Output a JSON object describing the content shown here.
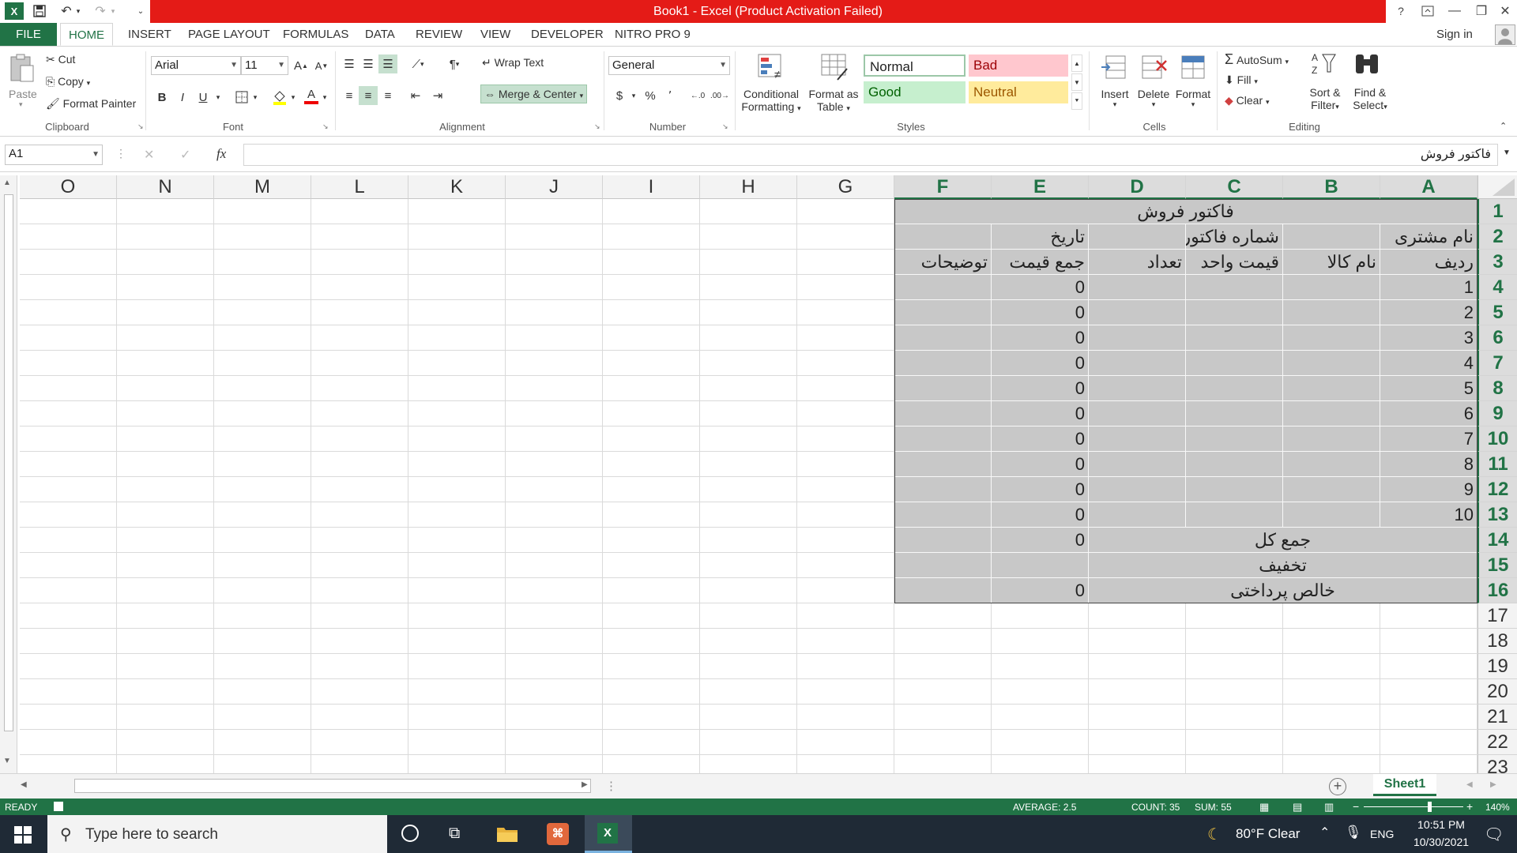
{
  "window": {
    "title": "Book1 -  Excel (Product Activation Failed)",
    "help": "?",
    "sign_in": "Sign in"
  },
  "tabs": [
    "FILE",
    "HOME",
    "INSERT",
    "PAGE LAYOUT",
    "FORMULAS",
    "DATA",
    "REVIEW",
    "VIEW",
    "DEVELOPER",
    "NITRO PRO 9"
  ],
  "ribbon": {
    "clipboard": {
      "paste": "Paste",
      "cut": "Cut",
      "copy": "Copy",
      "format_painter": "Format Painter",
      "label": "Clipboard"
    },
    "font": {
      "name": "Arial",
      "size": "11",
      "bold": "B",
      "italic": "I",
      "underline": "U",
      "label": "Font"
    },
    "alignment": {
      "wrap_text": "Wrap Text",
      "merge_center": "Merge & Center",
      "label": "Alignment"
    },
    "number": {
      "format": "General",
      "currency": "$",
      "percent": "%",
      "comma": "٬",
      "label": "Number"
    },
    "styles": {
      "conditional_formatting_1": "Conditional",
      "conditional_formatting_2": "Formatting",
      "format_as_table_1": "Format as",
      "format_as_table_2": "Table",
      "normal": "Normal",
      "bad": "Bad",
      "good": "Good",
      "neutral": "Neutral",
      "label": "Styles"
    },
    "cells": {
      "insert": "Insert",
      "delete": "Delete",
      "format": "Format",
      "label": "Cells"
    },
    "editing": {
      "autosum": "AutoSum",
      "fill": "Fill",
      "clear": "Clear",
      "sort_filter_1": "Sort &",
      "sort_filter_2": "Filter",
      "find_select_1": "Find &",
      "find_select_2": "Select",
      "label": "Editing"
    }
  },
  "formula_bar": {
    "name_box": "A1",
    "fx": "fx",
    "content": "فاکتور فروش"
  },
  "columns": [
    "A",
    "B",
    "C",
    "D",
    "E",
    "F",
    "G",
    "H",
    "I",
    "J",
    "K",
    "L",
    "M",
    "N",
    "O"
  ],
  "rows": [
    "1",
    "2",
    "3",
    "4",
    "5",
    "6",
    "7",
    "8",
    "9",
    "10",
    "11",
    "12",
    "13",
    "14",
    "15",
    "16",
    "17",
    "18",
    "19",
    "20",
    "21",
    "22",
    "23"
  ],
  "sheet": {
    "title": "فاکتور فروش",
    "customer_name": "نام مشتری",
    "invoice_number": "شماره فاکتور",
    "date": "تاریخ",
    "headers": [
      "ردیف",
      "نام کالا",
      "قیمت واحد",
      "تعداد",
      "جمع قیمت",
      "توضیحات"
    ],
    "row_numbers": [
      "1",
      "2",
      "3",
      "4",
      "5",
      "6",
      "7",
      "8",
      "9",
      "10"
    ],
    "row_totals": [
      "0",
      "0",
      "0",
      "0",
      "0",
      "0",
      "0",
      "0",
      "0",
      "0"
    ],
    "grand_total_label": "جمع کل",
    "grand_total": "0",
    "discount_label": "تخفیف",
    "net_payable_label": "خالص پرداختی",
    "net_payable": "0"
  },
  "sheet_tab": "Sheet1",
  "status": {
    "mode": "READY",
    "average": "AVERAGE: 2.5",
    "count": "COUNT: 35",
    "sum": "SUM: 55",
    "zoom": "140%",
    "zoom_level": 0.64
  },
  "taskbar": {
    "search_placeholder": "Type here to search",
    "weather": "80°F  Clear",
    "lang": "ENG",
    "time": "10:51 PM",
    "date": "10/30/2021"
  },
  "colors": {
    "excel_green": "#217346",
    "title_red": "#e41b17",
    "cell_grey": "#c8c8c8",
    "style_bad": "#ffc7ce",
    "style_good": "#c6efce",
    "style_neutral": "#ffeb9c"
  }
}
